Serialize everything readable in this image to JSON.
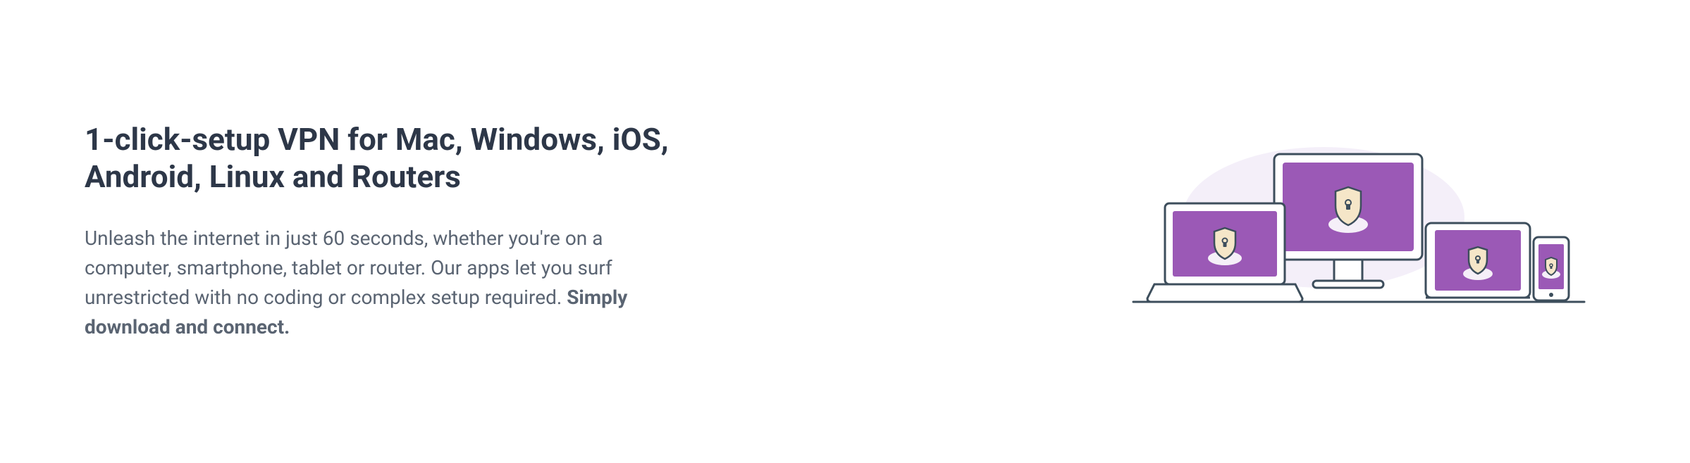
{
  "heading": "1-click-setup VPN for Mac, Windows, iOS, Android, Linux and Routers",
  "description_part1": "Unleash the internet in just 60 seconds, whether you're on a computer, smartphone, tablet or router. Our apps let you surf unrestricted with no coding or complex setup required. ",
  "description_strong": "Simply download and connect.",
  "illustration": {
    "devices": [
      "monitor",
      "laptop",
      "tablet",
      "phone"
    ],
    "icon": "shield-lock",
    "colors": {
      "device_fill": "#9b59b6",
      "device_stroke": "#3d4e5c",
      "shield_fill": "#f5e6c8",
      "shadow": "#e8dff5"
    }
  }
}
